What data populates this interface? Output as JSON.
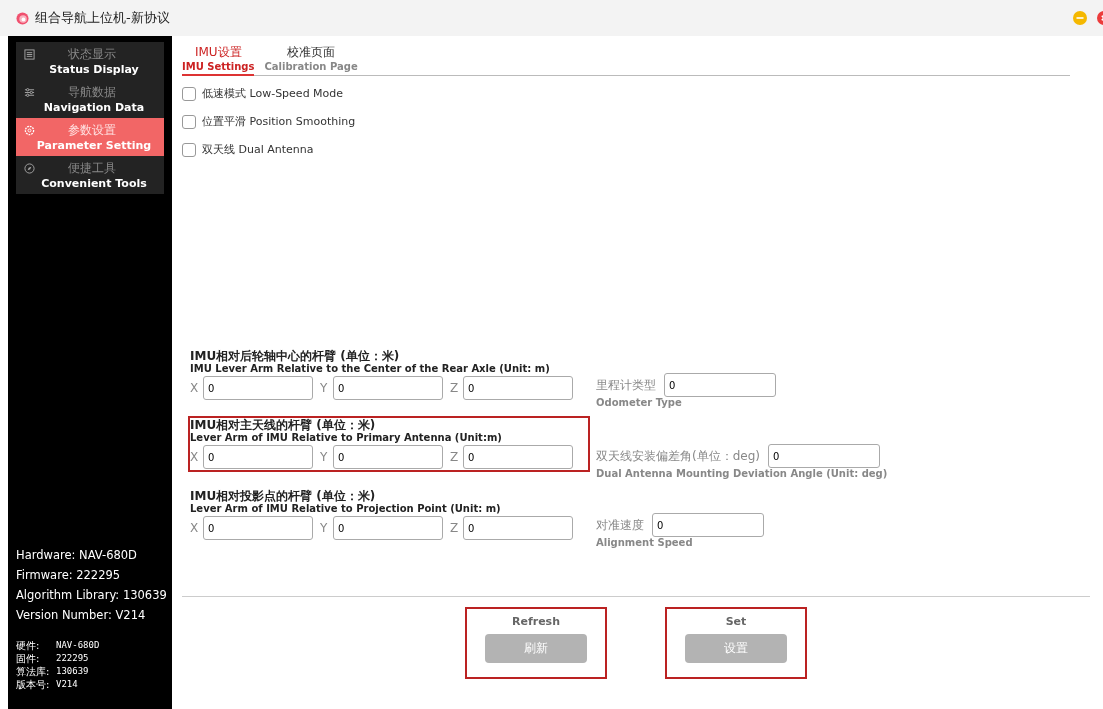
{
  "window": {
    "title": "组合导航上位机-新协议"
  },
  "sidebar": {
    "items": [
      {
        "label_cn": "状态显示",
        "label_en": "Status Display",
        "selected": false
      },
      {
        "label_cn": "导航数据",
        "label_en": "Navigation Data",
        "selected": false
      },
      {
        "label_cn": "参数设置",
        "label_en": "Parameter Setting",
        "selected": true
      },
      {
        "label_cn": "便捷工具",
        "label_en": "Convenient Tools",
        "selected": false
      }
    ],
    "info_en": [
      "Hardware: NAV-680D",
      "Firmware: 222295",
      "Algorithm Library: 130639",
      "Version Number: V214"
    ],
    "info_cn": [
      {
        "label": "硬件:",
        "value": "NAV-680D"
      },
      {
        "label": "固件:",
        "value": "222295"
      },
      {
        "label": "算法库:",
        "value": "130639"
      },
      {
        "label": "版本号:",
        "value": "V214"
      }
    ]
  },
  "tabs": [
    {
      "label_cn": "IMU设置",
      "label_en": "IMU Settings",
      "selected": true
    },
    {
      "label_cn": "校准页面",
      "label_en": "Calibration Page",
      "selected": false
    }
  ],
  "options": [
    {
      "label_cn": "低速模式",
      "label_en": "Low-Speed Mode",
      "checked": false
    },
    {
      "label_cn": "位置平滑",
      "label_en": "Position Smoothing",
      "checked": false
    },
    {
      "label_cn": "双天线",
      "label_en": "Dual Antenna",
      "checked": false
    }
  ],
  "groups": [
    {
      "title_cn": "IMU相对后轮轴中心的杆臂 (单位：米)",
      "title_en": "IMU Lever Arm Relative to the Center of the Rear Axle (Unit: m)",
      "highlighted": false,
      "fields": [
        {
          "label": "X",
          "value": "0"
        },
        {
          "label": "Y",
          "value": "0"
        },
        {
          "label": "Z",
          "value": "0"
        }
      ],
      "side": {
        "label_cn": "里程计类型",
        "label_en": "Odometer Type",
        "value": "0"
      }
    },
    {
      "title_cn": "IMU相对主天线的杆臂 (单位：米)",
      "title_en": "Lever Arm of IMU Relative to Primary Antenna (Unit:m)",
      "highlighted": true,
      "fields": [
        {
          "label": "X",
          "value": "0"
        },
        {
          "label": "Y",
          "value": "0"
        },
        {
          "label": "Z",
          "value": "0"
        }
      ],
      "side": {
        "label_cn": "双天线安装偏差角(单位：deg)",
        "label_en": "Dual Antenna Mounting Deviation Angle (Unit: deg)",
        "value": "0"
      }
    },
    {
      "title_cn": "IMU相对投影点的杆臂 (单位：米)",
      "title_en": "Lever Arm of IMU Relative to Projection Point (Unit: m)",
      "highlighted": false,
      "fields": [
        {
          "label": "X",
          "value": "0"
        },
        {
          "label": "Y",
          "value": "0"
        },
        {
          "label": "Z",
          "value": "0"
        }
      ],
      "side": {
        "label_cn": "对准速度",
        "label_en": "Alignment Speed",
        "value": "0"
      }
    }
  ],
  "actions": [
    {
      "caption": "Refresh",
      "label": "刷新",
      "highlighted": true
    },
    {
      "caption": "Set",
      "label": "设置",
      "highlighted": true
    }
  ]
}
